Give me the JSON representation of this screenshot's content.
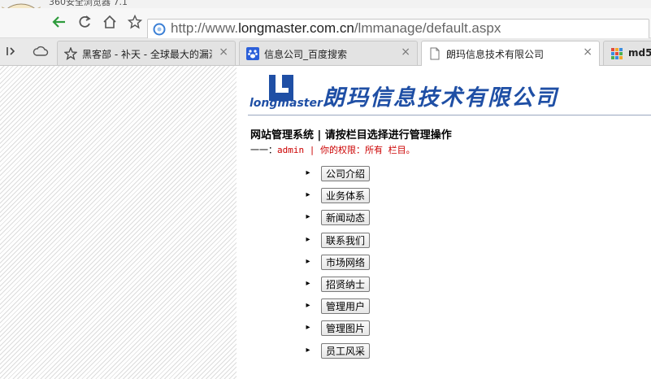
{
  "browser": {
    "title_text": "360安全浏览器 7.1",
    "address": {
      "scheme": "http://www.",
      "host": "longmaster.com.cn",
      "path": "/lmmanage/default.aspx"
    },
    "tabs": [
      {
        "title": "黑客部 - 补天 - 全球最大的漏洞",
        "active": false,
        "icon": "star-icon"
      },
      {
        "title": "信息公司_百度搜索",
        "active": false,
        "icon": "baidu-paw-icon"
      },
      {
        "title": "朗玛信息技术有限公司",
        "active": true,
        "icon": "page-icon"
      },
      {
        "title": "md5",
        "active": false,
        "icon": "grid-app-icon"
      }
    ],
    "tab_close_label": "×"
  },
  "site": {
    "logo_wordmark": "longmaster",
    "company_name": "朗玛信息技术有限公司",
    "system_title": "网站管理系统 | 请按栏目选择进行管理操作",
    "user_prefix": "一一：",
    "user_name": "admin",
    "permission_text": " | 你的权限：所有 栏目。",
    "bullet": "▸",
    "menu": [
      "公司介绍",
      "业务体系",
      "新闻动态",
      "联系我们",
      "市场网络",
      "招贤纳士",
      "管理用户",
      "管理图片",
      "员工风采"
    ]
  },
  "colors": {
    "brand_blue": "#1f4fa5",
    "warning_red": "#cc0000"
  }
}
